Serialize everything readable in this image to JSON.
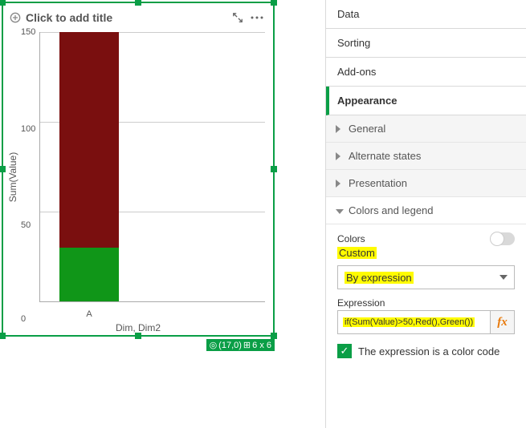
{
  "chart_title_placeholder": "Click to add title",
  "status": {
    "pos": "(17,0)",
    "size": "6 x 6"
  },
  "xlabel": "Dim, Dim2",
  "ylabel": "Sum(Value)",
  "chart_data": {
    "type": "bar",
    "title": "",
    "categories": [
      "A"
    ],
    "ylabel": "Sum(Value)",
    "xlabel": "Dim, Dim2",
    "ylim": [
      0,
      150
    ],
    "yticks": [
      0,
      50,
      100,
      150
    ],
    "stacks": [
      {
        "category": "A",
        "segments": [
          {
            "value": 30,
            "color": "#109618"
          },
          {
            "value": 120,
            "color": "#7a0f0f"
          }
        ]
      }
    ]
  },
  "panel": {
    "tabs": [
      "Data",
      "Sorting",
      "Add-ons",
      "Appearance"
    ],
    "active_tab": "Appearance",
    "sub_items": {
      "general": "General",
      "alt_states": "Alternate states",
      "presentation": "Presentation",
      "colors_legend": "Colors and legend"
    },
    "colors_section": {
      "colors_label": "Colors",
      "custom_label": "Custom",
      "dropdown_value": "By expression",
      "expression_label": "Expression",
      "expression_value": "if(Sum(Value)>50,Red(),Green())",
      "fx_label": "fx",
      "checkbox_label": "The expression is a color code"
    }
  }
}
